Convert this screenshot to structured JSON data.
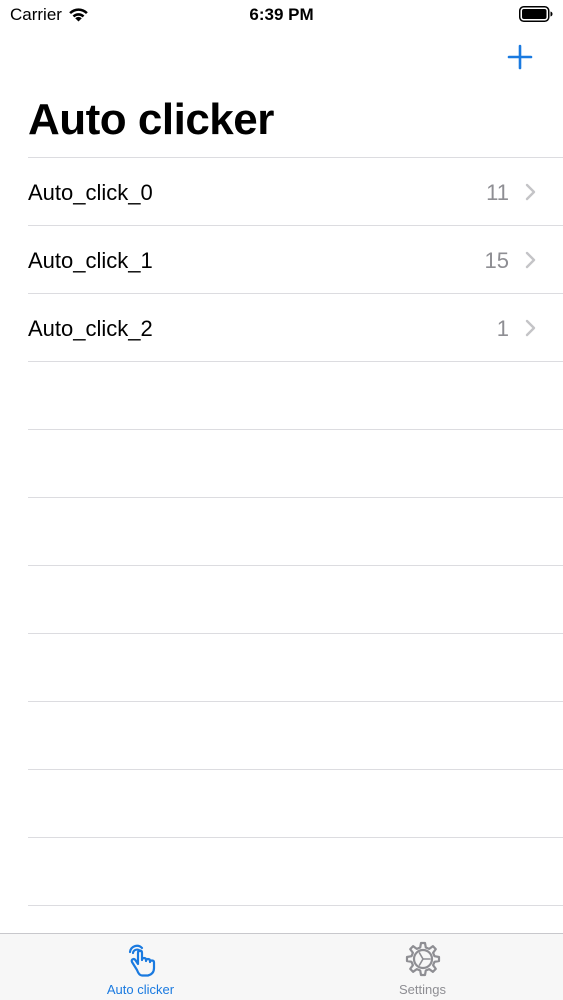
{
  "status_bar": {
    "carrier": "Carrier",
    "time": "6:39 PM",
    "wifi_icon": "wifi-icon",
    "battery_icon": "battery-full-icon"
  },
  "nav": {
    "title": "Auto clicker",
    "add_icon": "plus-icon",
    "accent_color": "#1a7ae0"
  },
  "list": {
    "items": [
      {
        "label": "Auto_click_0",
        "count": "11"
      },
      {
        "label": "Auto_click_1",
        "count": "15"
      },
      {
        "label": "Auto_click_2",
        "count": "1"
      }
    ]
  },
  "tab_bar": {
    "tabs": [
      {
        "label": "Auto clicker",
        "icon": "tap-hand-icon",
        "selected": true,
        "color": "#1a7ae0"
      },
      {
        "label": "Settings",
        "icon": "gear-icon",
        "selected": false,
        "color": "#8e8e93"
      }
    ]
  }
}
